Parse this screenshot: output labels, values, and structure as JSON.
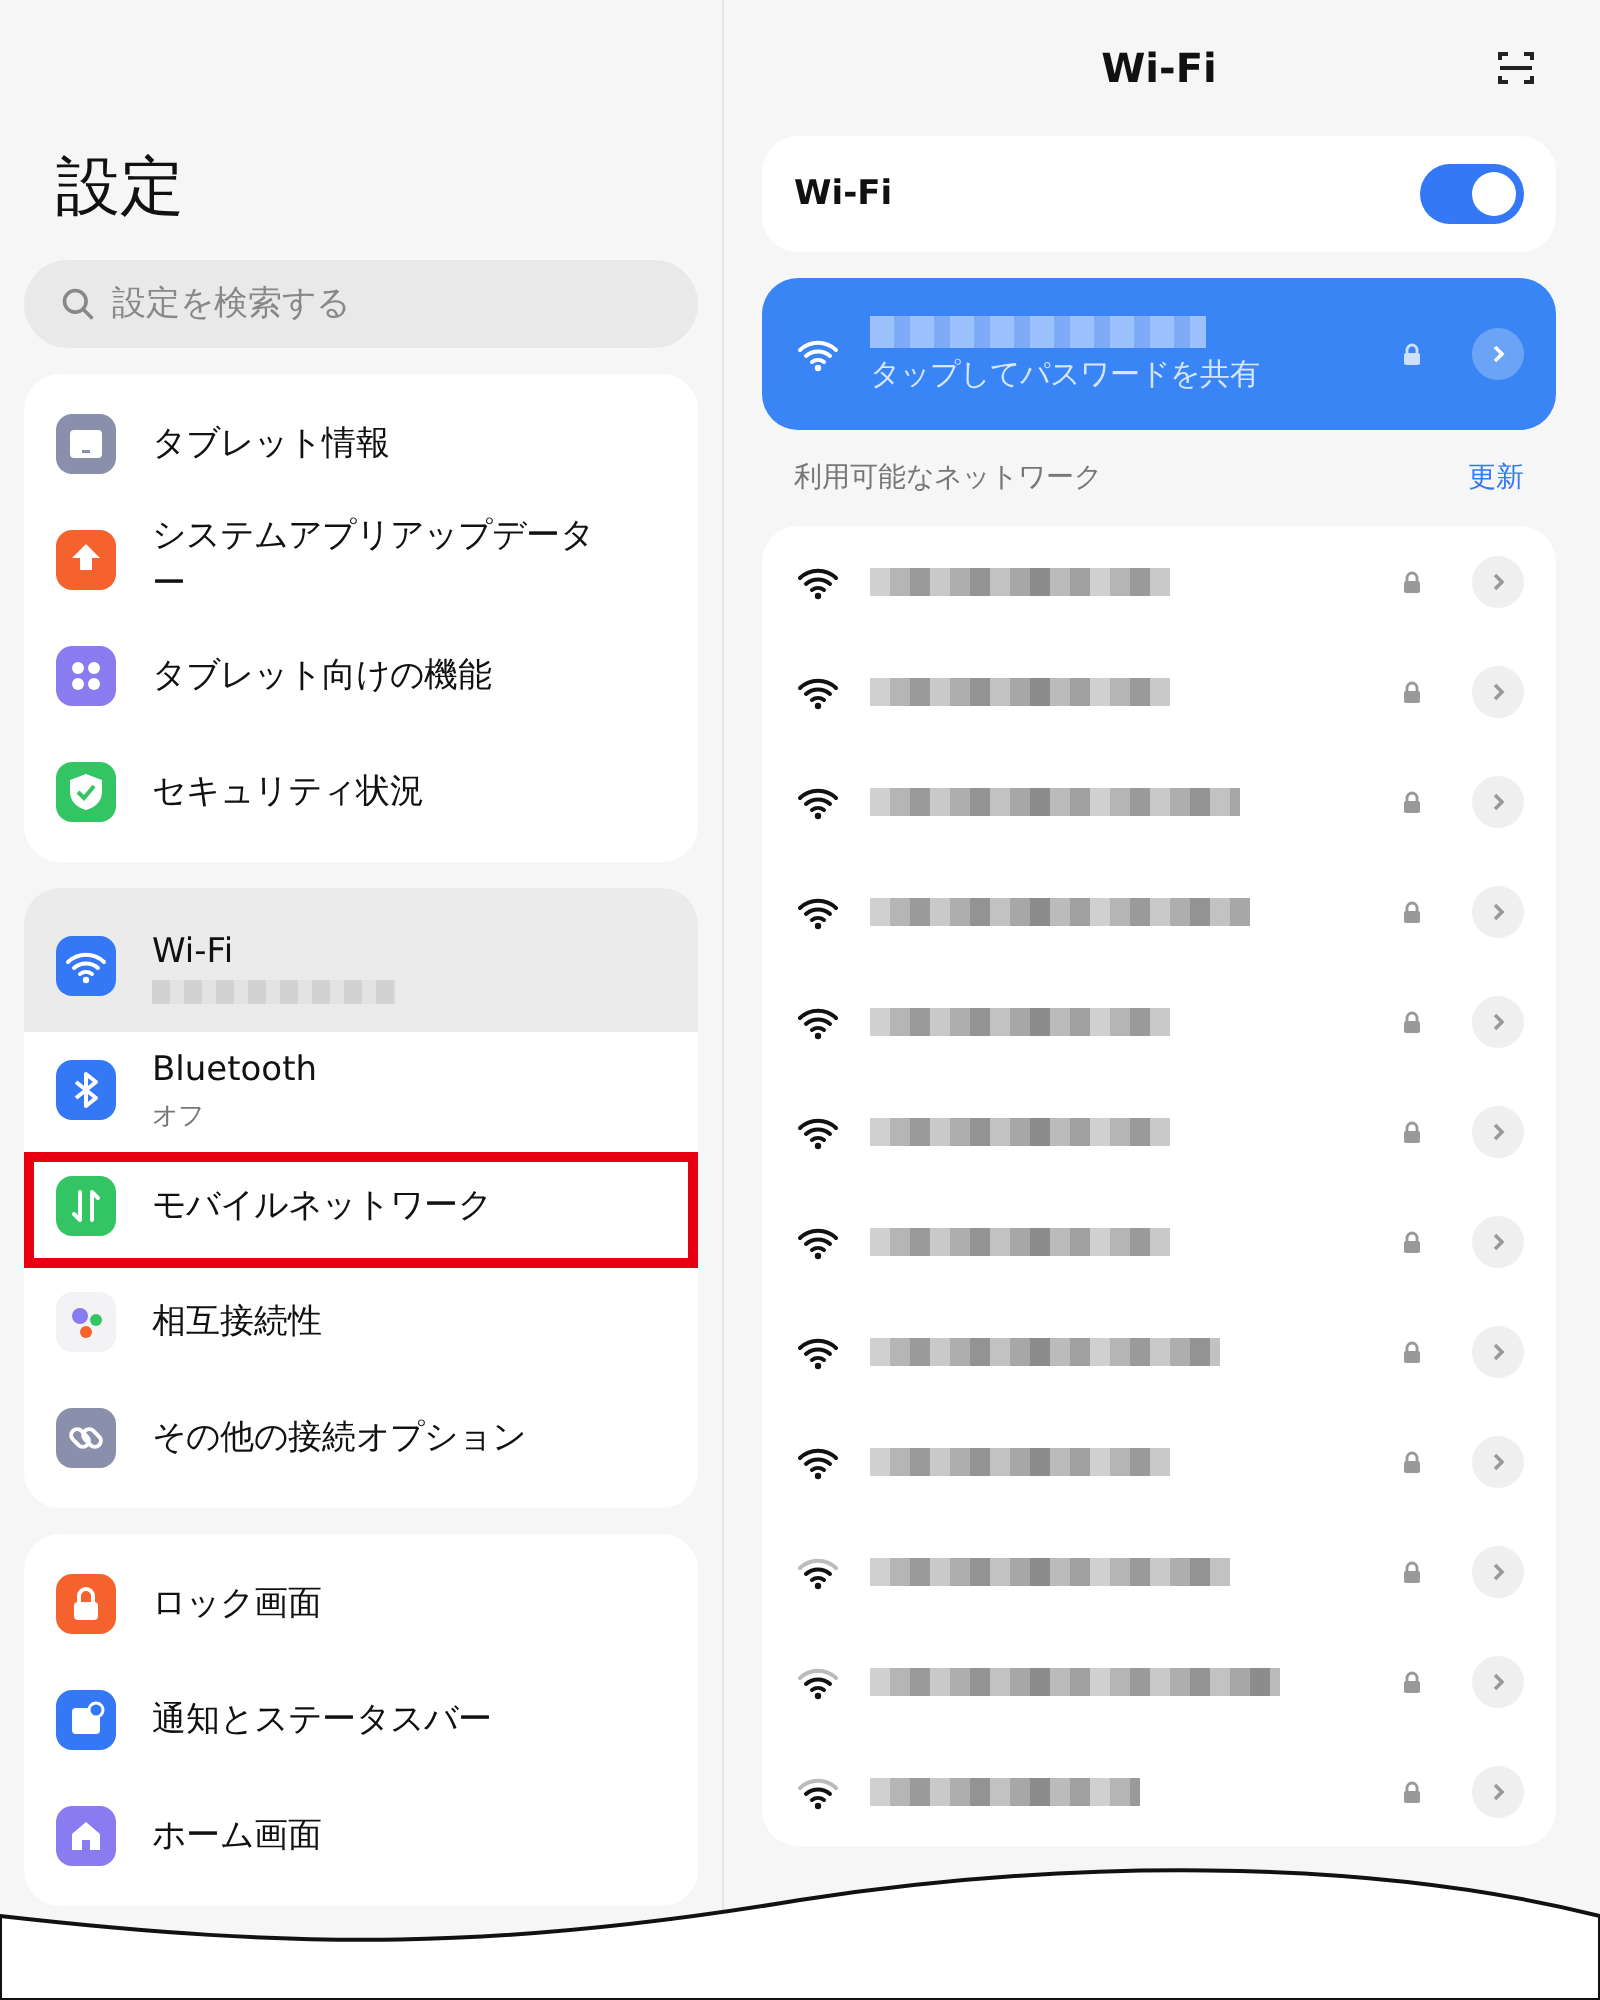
{
  "sidebar": {
    "title": "設定",
    "search": {
      "placeholder": "設定を検索する"
    },
    "groups": [
      {
        "items": [
          {
            "label": "タブレット情報",
            "kind": "tablet",
            "color": "#8a90ab",
            "selected": false,
            "highlighted": false
          },
          {
            "label": "システムアプリアップデーター",
            "kind": "update",
            "color": "#f5622e",
            "selected": false,
            "highlighted": false
          },
          {
            "label": "タブレット向けの機能",
            "kind": "dots",
            "color": "#8a7cf0",
            "selected": false,
            "highlighted": false
          },
          {
            "label": "セキュリティ状況",
            "kind": "shield",
            "color": "#33c463",
            "selected": false,
            "highlighted": false
          }
        ]
      },
      {
        "items": [
          {
            "label": "Wi-Fi",
            "kind": "wifi",
            "color": "#3478f6",
            "selected": true,
            "highlighted": false,
            "redacted_subtitle": true
          },
          {
            "label": "Bluetooth",
            "subtitle": "オフ",
            "kind": "bluetooth",
            "color": "#3478f6",
            "selected": false,
            "highlighted": false
          },
          {
            "label": "モバイルネットワーク",
            "kind": "mobile",
            "color": "#33c463",
            "selected": false,
            "highlighted": true
          },
          {
            "label": "相互接続性",
            "kind": "bubbles",
            "color": "#f3f3f5",
            "selected": false,
            "highlighted": false
          },
          {
            "label": "その他の接続オプション",
            "kind": "link",
            "color": "#8a90ab",
            "selected": false,
            "highlighted": false
          }
        ]
      },
      {
        "items": [
          {
            "label": "ロック画面",
            "kind": "lock",
            "color": "#f5622e",
            "selected": false,
            "highlighted": false
          },
          {
            "label": "通知とステータスバー",
            "kind": "notify",
            "color": "#3478f6",
            "selected": false,
            "highlighted": false
          },
          {
            "label": "ホーム画面",
            "kind": "home",
            "color": "#8a7cf0",
            "selected": false,
            "highlighted": false
          }
        ]
      }
    ]
  },
  "wifi_page": {
    "title": "Wi-Fi",
    "toggle": {
      "label": "Wi-Fi",
      "on": true
    },
    "connected": {
      "subtitle": "タップしてパスワードを共有"
    },
    "section_label": "利用可能なネットワーク",
    "refresh": "更新",
    "networks": [
      {
        "kind": "strong"
      },
      {
        "kind": "strong"
      },
      {
        "kind": "strong"
      },
      {
        "kind": "strong"
      },
      {
        "kind": "strong"
      },
      {
        "kind": "strong"
      },
      {
        "kind": "strong"
      },
      {
        "kind": "strong"
      },
      {
        "kind": "strong"
      },
      {
        "kind": "medium"
      },
      {
        "kind": "medium"
      },
      {
        "kind": "medium"
      }
    ]
  }
}
